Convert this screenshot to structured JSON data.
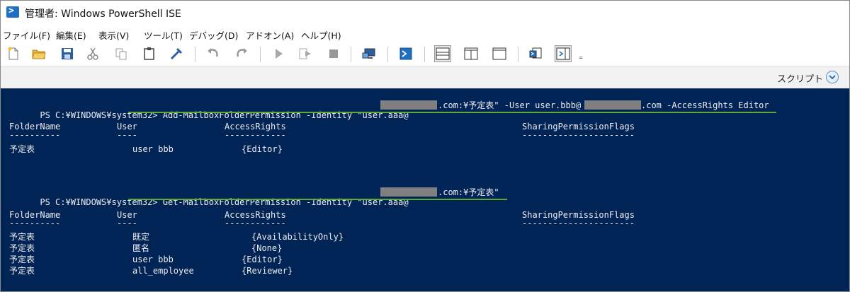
{
  "window": {
    "title": "管理者: Windows PowerShell ISE"
  },
  "menu": [
    {
      "label": "ファイル(F)"
    },
    {
      "label": "編集(E)"
    },
    {
      "label": "表示(V)"
    },
    {
      "label": "ツール(T)"
    },
    {
      "label": "デバッグ(D)"
    },
    {
      "label": "アドオン(A)"
    },
    {
      "label": "ヘルプ(H)"
    }
  ],
  "toolbar": {
    "icons": [
      "new-file-icon",
      "open-folder-icon",
      "save-icon",
      "cut-icon",
      "copy-icon",
      "paste-icon",
      "clear-console-icon",
      "undo-icon",
      "redo-icon",
      "run-script-icon",
      "run-selection-icon",
      "stop-icon",
      "remote-powershell-icon",
      "powershell-console-icon",
      "show-script-top-icon",
      "show-script-right-icon",
      "show-script-max-icon",
      "show-commands-icon",
      "show-addon-icon",
      "overflow-icon"
    ],
    "overflow_glyph": "₌"
  },
  "scriptbar": {
    "label": "スクリプト"
  },
  "console": {
    "cmd1": {
      "prompt": "PS C:¥WINDOWS¥system32>",
      "part1": " Add-MailboxFolderPermission -Identity \"user.aaa@",
      "part2": ".com:¥予定表\" -User user.bbb@",
      "part3": ".com -AccessRights Editor"
    },
    "headers": {
      "folder": "FolderName",
      "user": "User",
      "rights": "AccessRights",
      "sharing": "SharingPermissionFlags",
      "folder_dash": "----------",
      "user_dash": "----",
      "rights_dash": "------------",
      "sharing_dash": "----------------------"
    },
    "result1": [
      {
        "folder": "予定表",
        "user": "user bbb",
        "rights": "{Editor}"
      }
    ],
    "cmd2": {
      "prompt": "PS C:¥WINDOWS¥system32>",
      "part1": " Get-MailboxFolderPermission -Identity \"user.aaa@",
      "part2": ".com:¥予定表\""
    },
    "result2": [
      {
        "folder": "予定表",
        "user": "既定",
        "rights": "{AvailabilityOnly}"
      },
      {
        "folder": "予定表",
        "user": "匿名",
        "rights": "{None}"
      },
      {
        "folder": "予定表",
        "user": "user bbb",
        "rights": "{Editor}"
      },
      {
        "folder": "予定表",
        "user": "all_employee",
        "rights": "{Reviewer}"
      }
    ]
  }
}
